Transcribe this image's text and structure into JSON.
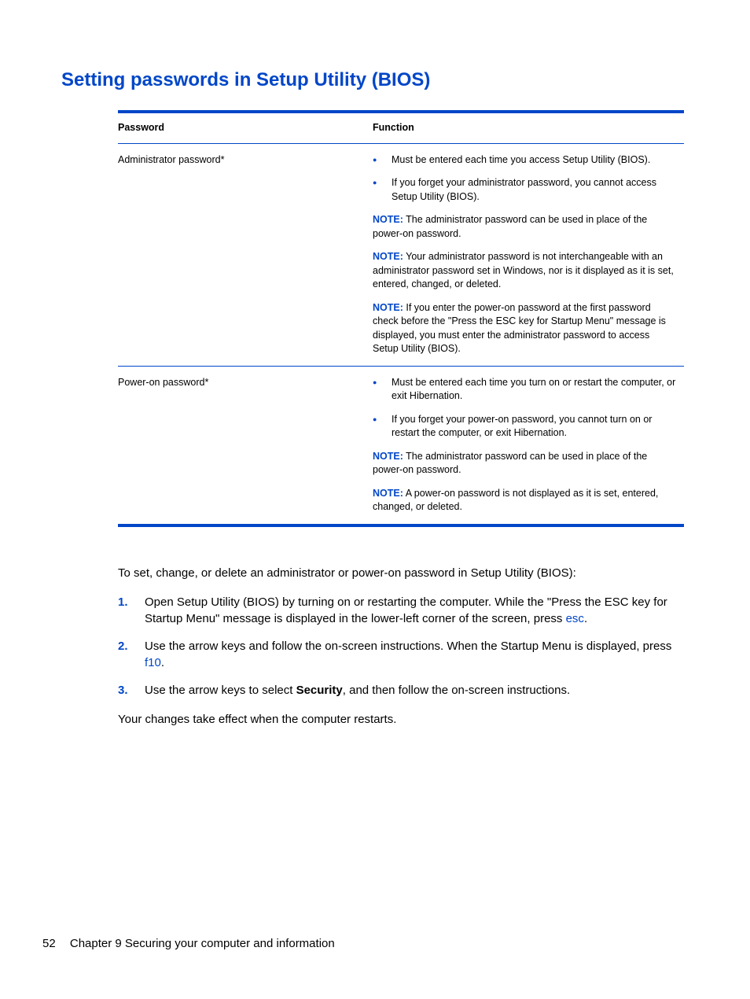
{
  "heading": "Setting passwords in Setup Utility (BIOS)",
  "table": {
    "headers": {
      "password": "Password",
      "function": "Function"
    },
    "rows": [
      {
        "name": "Administrator password*",
        "bullets": [
          "Must be entered each time you access Setup Utility (BIOS).",
          "If you forget your administrator password, you cannot access Setup Utility (BIOS)."
        ],
        "notes": [
          "The administrator password can be used in place of the power-on password.",
          "Your administrator password is not interchangeable with an administrator password set in Windows, nor is it displayed as it is set, entered, changed, or deleted.",
          "If you enter the power-on password at the first password check before the \"Press the ESC key for Startup Menu\" message is displayed, you must enter the administrator password to access Setup Utility (BIOS)."
        ]
      },
      {
        "name": "Power-on password*",
        "bullets": [
          "Must be entered each time you turn on or restart the computer, or exit Hibernation.",
          "If you forget your power-on password, you cannot turn on or restart the computer, or exit Hibernation."
        ],
        "notes": [
          "The administrator password can be used in place of the power-on password.",
          "A power-on password is not displayed as it is set, entered, changed, or deleted."
        ]
      }
    ]
  },
  "note_label": "NOTE:",
  "intro": "To set, change, or delete an administrator or power-on password in Setup Utility (BIOS):",
  "steps": [
    {
      "num": "1.",
      "pre": "Open Setup Utility (BIOS) by turning on or restarting the computer. While the \"Press the ESC key for Startup Menu\" message is displayed in the lower-left corner of the screen, press ",
      "key": "esc",
      "post": "."
    },
    {
      "num": "2.",
      "pre": "Use the arrow keys and follow the on-screen instructions. When the Startup Menu is displayed, press ",
      "key": "f10",
      "post": "."
    },
    {
      "num": "3.",
      "pre": "Use the arrow keys to select ",
      "bold": "Security",
      "post": ", and then follow the on-screen instructions."
    }
  ],
  "outro": "Your changes take effect when the computer restarts.",
  "footer": {
    "page": "52",
    "chapter": "Chapter 9   Securing your computer and information"
  }
}
